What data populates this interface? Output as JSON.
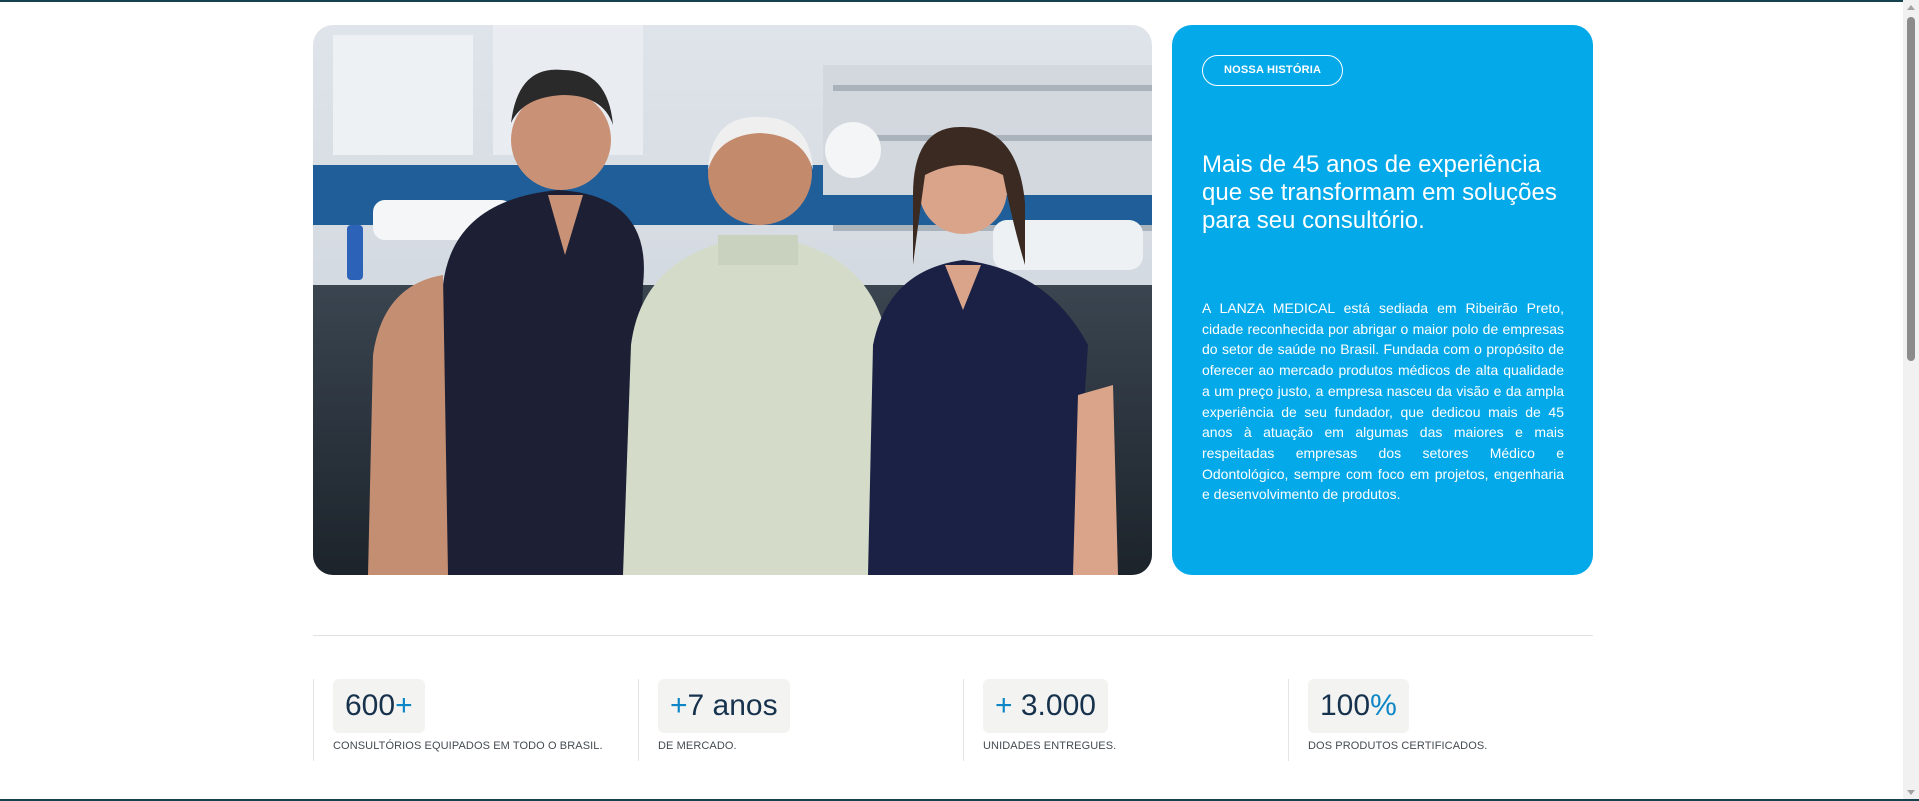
{
  "hero": {
    "photo_alt": "Três pessoas posando na fábrica"
  },
  "card": {
    "pill_label": "NOSSA HISTÓRIA",
    "title": "Mais de 45 anos de experiência que se transformam em soluções para seu consultório.",
    "body": "A LANZA MEDICAL está sediada em Ribeirão Preto, cidade reconhecida por abrigar o maior polo de empresas do setor de saúde no Brasil. Fundada com o propósito de oferecer ao mercado produtos médicos de alta qualidade a um preço justo, a empresa nasceu da visão e da ampla experiência de seu fundador, que dedicou mais de 45 anos à atuação em algumas das maiores e mais respeitadas empresas dos setores Médico e Odontológico, sempre com foco em projetos, engenharia e desenvolvimento de produtos."
  },
  "stats": [
    {
      "prefix": "",
      "number": "600",
      "suffix": "+",
      "label": "CONSULTÓRIOS EQUIPADOS EM TODO O BRASIL."
    },
    {
      "prefix": "+",
      "number": "7 anos",
      "suffix": "",
      "label": "DE MERCADO."
    },
    {
      "prefix": "+ ",
      "number": "3.000",
      "suffix": "",
      "label": "UNIDADES ENTREGUES."
    },
    {
      "prefix": "",
      "number": "100",
      "suffix": "%",
      "label": "DOS PRODUTOS CERTIFICADOS."
    }
  ],
  "colors": {
    "card_background": "#03a9e9",
    "stat_number": "#17324d",
    "stat_accent": "#0d86c6",
    "stat_chip": "#f3f3f1"
  }
}
